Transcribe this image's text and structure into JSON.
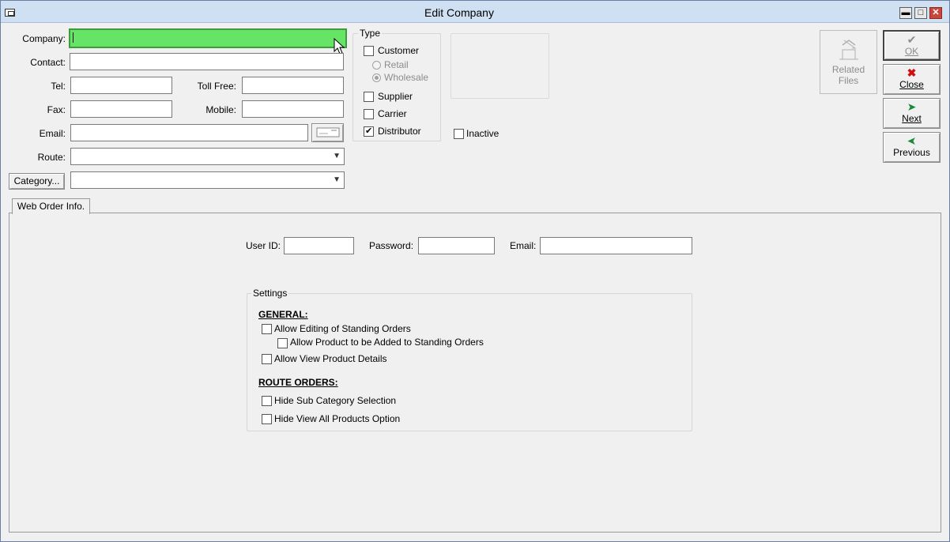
{
  "window": {
    "title": "Edit Company",
    "controls": {
      "minimize": "▬",
      "maximize": "□",
      "close": "✕"
    }
  },
  "form": {
    "company": {
      "label": "Company:",
      "value": ""
    },
    "contact": {
      "label": "Contact:",
      "value": ""
    },
    "tel": {
      "label": "Tel:",
      "value": ""
    },
    "toll_free": {
      "label": "Toll Free:",
      "value": ""
    },
    "fax": {
      "label": "Fax:",
      "value": ""
    },
    "mobile": {
      "label": "Mobile:",
      "value": ""
    },
    "email": {
      "label": "Email:",
      "value": ""
    },
    "route": {
      "label": "Route:",
      "value": ""
    },
    "category": {
      "button_label": "Category...",
      "value": ""
    }
  },
  "type_group": {
    "title": "Type",
    "customer": {
      "label": "Customer",
      "checked": false
    },
    "retail": {
      "label": "Retail",
      "selected": false
    },
    "wholesale": {
      "label": "Wholesale",
      "selected": true
    },
    "supplier": {
      "label": "Supplier",
      "checked": false
    },
    "carrier": {
      "label": "Carrier",
      "checked": false
    },
    "distributor": {
      "label": "Distributor",
      "checked": true
    }
  },
  "inactive": {
    "label": "Inactive",
    "checked": false
  },
  "buttons": {
    "related_files": {
      "line1": "Related",
      "line2": "Files",
      "icon": "folder-tree-icon"
    },
    "ok": {
      "label": "OK",
      "icon": "checkmark-icon"
    },
    "close": {
      "label": "Close",
      "icon": "x-icon"
    },
    "next": {
      "label": "Next",
      "icon": "next-arrow-icon"
    },
    "previous": {
      "label": "Previous",
      "icon": "previous-arrow-icon"
    }
  },
  "tabs": [
    {
      "label": "Web Order Info."
    }
  ],
  "web_order": {
    "user_id": {
      "label": "User ID:",
      "value": ""
    },
    "password": {
      "label": "Password:",
      "value": ""
    },
    "email": {
      "label": "Email:",
      "value": ""
    }
  },
  "settings": {
    "title": "Settings",
    "general_heading": "GENERAL:",
    "allow_editing_standing": {
      "label": "Allow Editing of Standing Orders",
      "checked": false
    },
    "allow_product_added": {
      "label": "Allow Product to be Added to Standing Orders",
      "checked": false
    },
    "allow_view_details": {
      "label": "Allow View Product Details",
      "checked": false
    },
    "route_heading": "ROUTE ORDERS:",
    "hide_sub_category": {
      "label": "Hide Sub Category Selection",
      "checked": false
    },
    "hide_view_all": {
      "label": "Hide View All Products Option",
      "checked": false
    }
  },
  "colors": {
    "focus_field": "#66e466",
    "titlebar": "#cfe0f3",
    "close_button": "#c9463d"
  }
}
